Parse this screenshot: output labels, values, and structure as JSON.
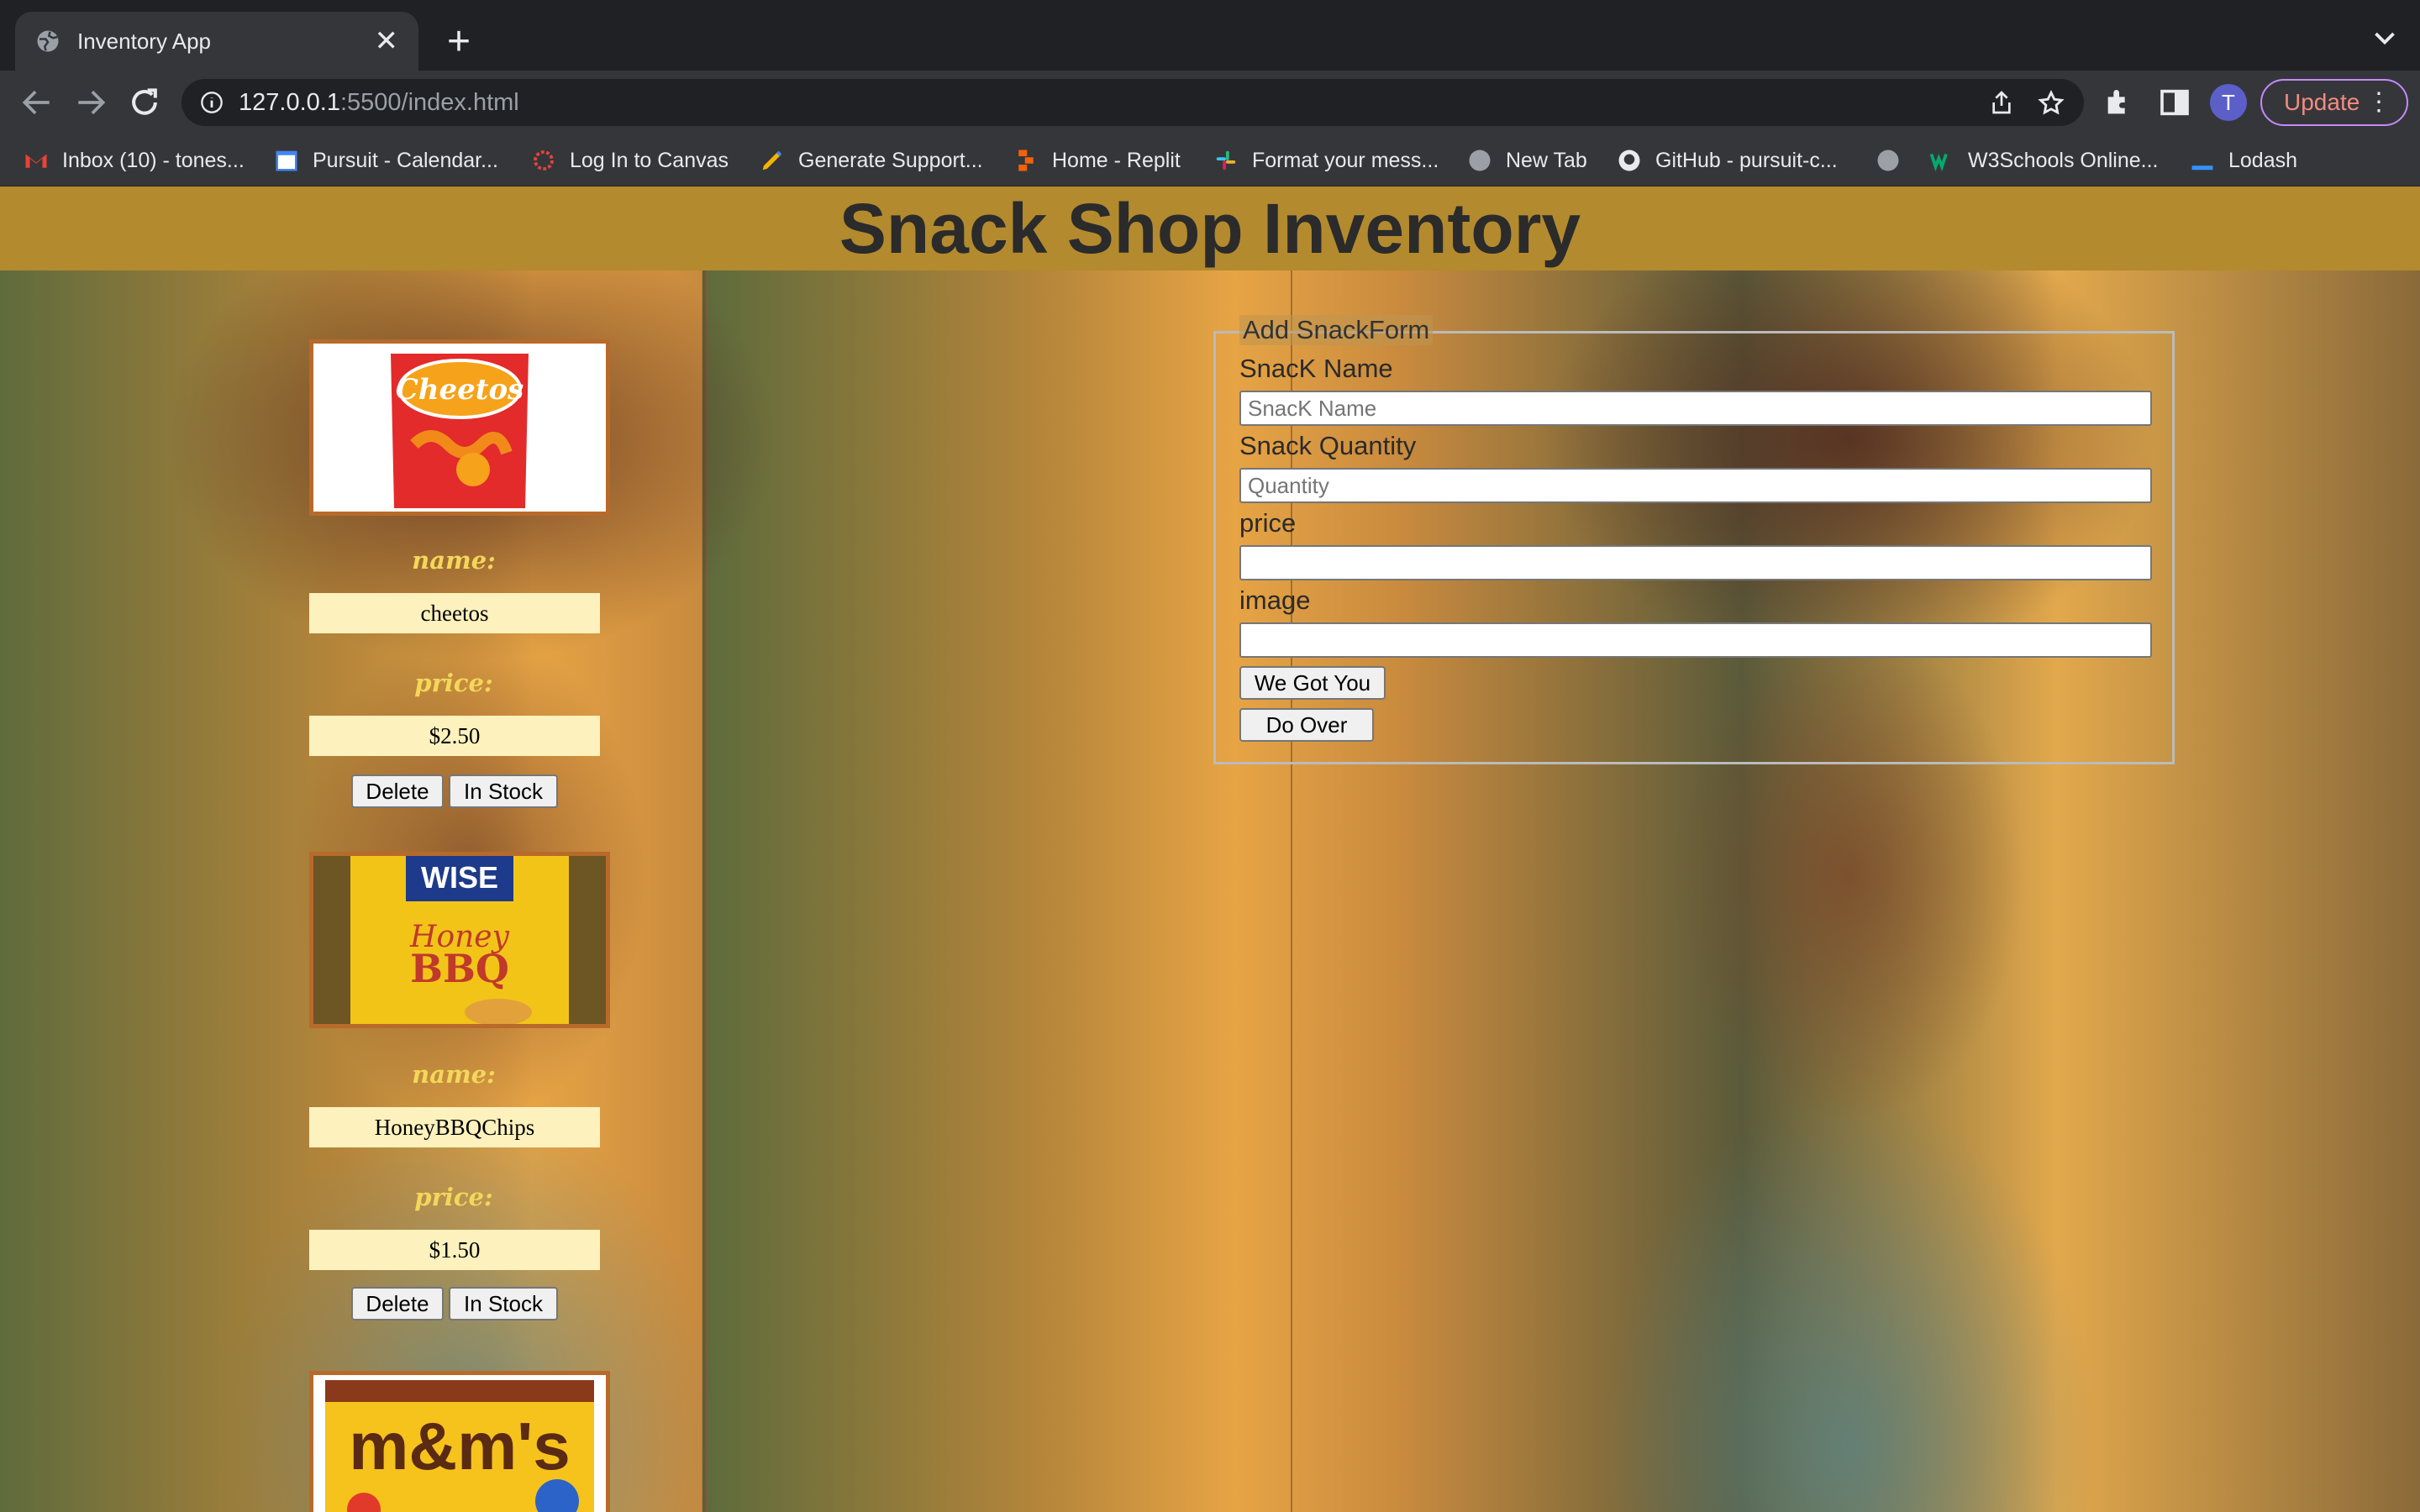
{
  "browser": {
    "tab_title": "Inventory App",
    "url_host": "127.0.0.1",
    "url_rest": ":5500/index.html",
    "avatar_initial": "T",
    "update_label": "Update",
    "bookmarks": [
      {
        "label": "Inbox (10) - tones...",
        "icon": "gmail-icon"
      },
      {
        "label": "Pursuit - Calendar...",
        "icon": "calendar-icon"
      },
      {
        "label": "Log In to Canvas",
        "icon": "canvas-icon"
      },
      {
        "label": "Generate Support...",
        "icon": "pencil-icon"
      },
      {
        "label": "Home - Replit",
        "icon": "replit-icon"
      },
      {
        "label": "Format your mess...",
        "icon": "slack-icon"
      },
      {
        "label": "New Tab",
        "icon": "globe-icon"
      },
      {
        "label": "GitHub - pursuit-c...",
        "icon": "github-icon"
      },
      {
        "label": "",
        "icon": "globe-icon"
      },
      {
        "label": "W3Schools Online...",
        "icon": "w3schools-icon"
      },
      {
        "label": "Lodash",
        "icon": "lodash-icon"
      }
    ]
  },
  "page": {
    "title": "Snack Shop Inventory"
  },
  "snacks": [
    {
      "name_label": "name:",
      "name": "cheetos",
      "price_label": "price:",
      "price": "$2.50",
      "delete_label": "Delete",
      "stock_label": "In Stock",
      "image": "cheetos-bag"
    },
    {
      "name_label": "name:",
      "name": "HoneyBBQChips",
      "price_label": "price:",
      "price": "$1.50",
      "delete_label": "Delete",
      "stock_label": "In Stock",
      "image": "wise-honey-bbq-bag"
    },
    {
      "image": "mms-peanut-bag"
    }
  ],
  "form": {
    "legend": "Add SnackForm",
    "name_label": "SnacK Name",
    "name_placeholder": "SnacK Name",
    "quantity_label": "Snack Quantity",
    "quantity_placeholder": "Quantity",
    "price_label": "price",
    "image_label": "image",
    "submit_label": "We Got You",
    "reset_label": "Do Over"
  },
  "colors": {
    "header_bg": "#b38a2e",
    "card_border": "#b86a2a",
    "label_yellow": "#f3d75a",
    "value_bg": "#fdf1bd",
    "update_text": "#f28b82"
  }
}
